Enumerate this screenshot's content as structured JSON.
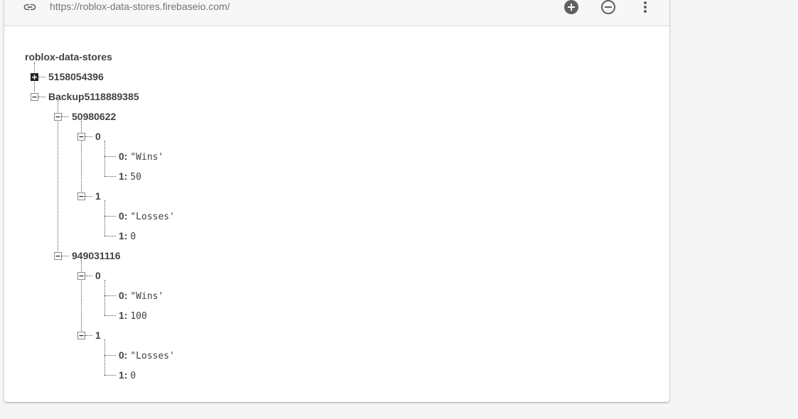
{
  "toolbar": {
    "url": "https://roblox-data-stores.firebaseio.com/",
    "icons": [
      "link-icon",
      "add-circle-icon",
      "remove-circle-icon",
      "more-vert-icon"
    ]
  },
  "tree": {
    "root": "roblox-data-stores",
    "nodes": [
      {
        "key": "5158054396",
        "state": "collapsed"
      },
      {
        "key": "Backup5118889385",
        "state": "expanded"
      },
      {
        "key": "50980622",
        "state": "expanded"
      },
      {
        "key": "0",
        "state": "expanded"
      },
      {
        "key": "0:",
        "value": "\"Wins'"
      },
      {
        "key": "1:",
        "value": "50"
      },
      {
        "key": "1",
        "state": "expanded"
      },
      {
        "key": "0:",
        "value": "\"Losses'"
      },
      {
        "key": "1:",
        "value": "0"
      },
      {
        "key": "949031116",
        "state": "expanded"
      },
      {
        "key": "0",
        "state": "expanded"
      },
      {
        "key": "0:",
        "value": "\"Wins'"
      },
      {
        "key": "1:",
        "value": "100"
      },
      {
        "key": "1",
        "state": "expanded"
      },
      {
        "key": "0:",
        "value": "\"Losses'"
      },
      {
        "key": "1:",
        "value": "0"
      }
    ]
  },
  "colors": {
    "card": "#ffffff",
    "toolbar": "#f7f7f7",
    "text": "#424242",
    "url": "#757575",
    "icon": "#616161"
  }
}
